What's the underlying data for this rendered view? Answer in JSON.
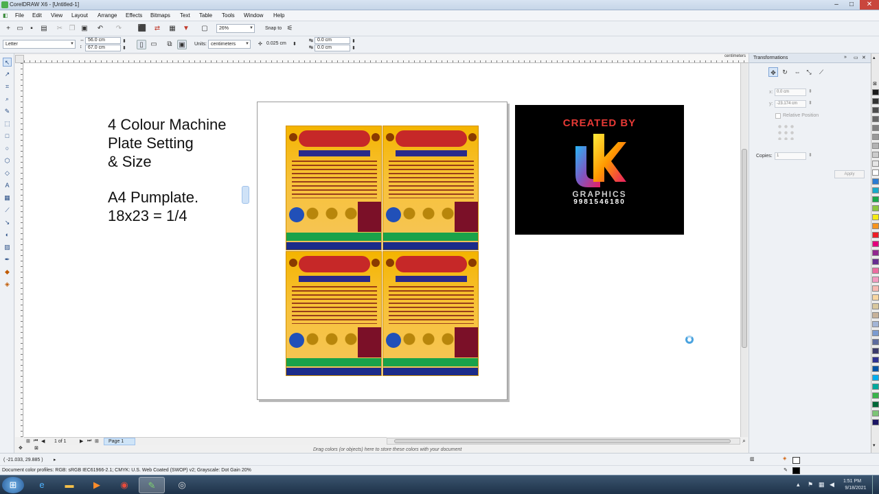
{
  "app": {
    "title": "CorelDRAW X6 - [Untitled-1]"
  },
  "window_controls": {
    "minimize": "–",
    "maximize": "□",
    "close": "✕"
  },
  "menu": [
    "File",
    "Edit",
    "View",
    "Layout",
    "Arrange",
    "Effects",
    "Bitmaps",
    "Text",
    "Table",
    "Tools",
    "Window",
    "Help"
  ],
  "toolbar": {
    "zoom": "26%",
    "snap_to": "Snap to"
  },
  "propbar": {
    "paper": "Letter",
    "width": "56.0 cm",
    "height": "67.0 cm",
    "units_label": "Units:",
    "units": "centimeters",
    "nudge": "0.025 cm",
    "dup_x": "0.0 cm",
    "dup_y": "0.0 cm"
  },
  "ruler": {
    "units": "centimeters"
  },
  "canvas": {
    "text_block_1": [
      "4 Colour Machine",
      "Plate Setting",
      "& Size"
    ],
    "text_block_2": [
      "A4 Pumplate.",
      "18x23 = 1/4"
    ]
  },
  "logo": {
    "created_by": "CREATED BY",
    "brand": "GRAPHICS",
    "phone": "9981546180"
  },
  "pagenav": {
    "page_count": "1 of 1",
    "page_tab": "Page 1"
  },
  "docker": {
    "title": "Transformations",
    "x_label": "x:",
    "x_value": "0.0 cm",
    "y_label": "y:",
    "y_value": "-23.174 cm",
    "relative": "Relative Position",
    "copies_label": "Copies:",
    "copies_value": "1",
    "apply": "Apply"
  },
  "palette": [
    "#1a1a1a",
    "#333333",
    "#4d4d4d",
    "#666666",
    "#808080",
    "#999999",
    "#b3b3b3",
    "#cccccc",
    "#e6e6e6",
    "#ffffff",
    "#2b7bd3",
    "#18a9c9",
    "#19a84a",
    "#8cc63f",
    "#f6eb14",
    "#f7941d",
    "#ed1c24",
    "#e4007c",
    "#92278f",
    "#662d91",
    "#ec6ba0",
    "#f39ac1",
    "#f7b9b1",
    "#f9d6a0",
    "#d9c89e",
    "#c7b299",
    "#a3b5d6",
    "#7b9bd0",
    "#5d6b9e",
    "#3b3a6b",
    "#2e3192",
    "#0054a6",
    "#00aeef",
    "#00a99d",
    "#39b54a",
    "#006837",
    "#7cc576",
    "#1b1464"
  ],
  "status": {
    "coords": "( -21.033, 29.885 )",
    "hint": "Drag colors (or objects) here to store these colors with your document",
    "profiles": "Document color profiles: RGB: sRGB IEC61966-2.1; CMYK: U.S. Web Coated (SWOP) v2; Grayscale: Dot Gain 20%"
  },
  "taskbar": {
    "time": "1:51 PM",
    "date": "9/18/2021"
  }
}
